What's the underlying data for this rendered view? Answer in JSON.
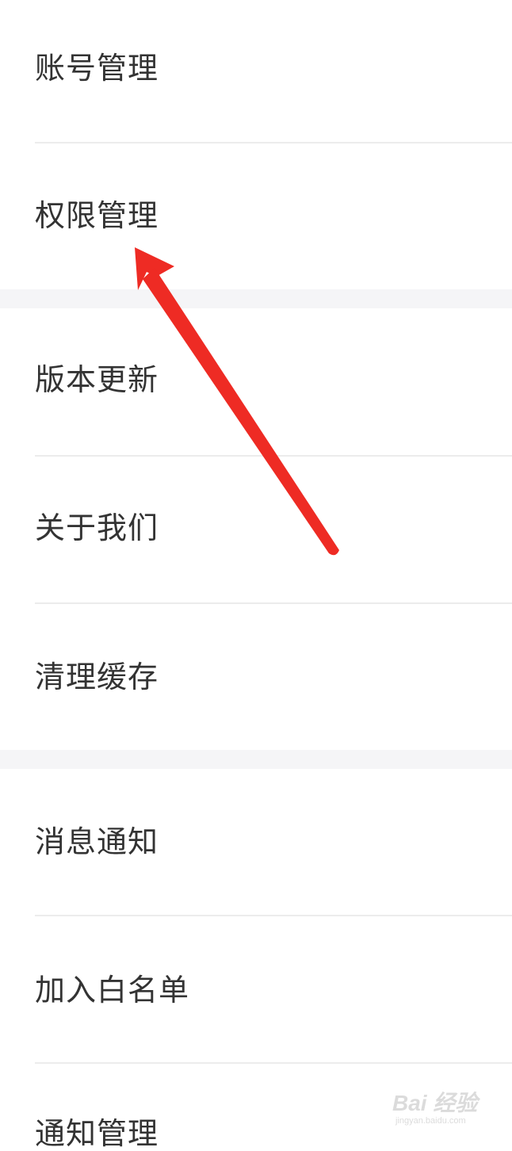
{
  "settings": {
    "items": [
      {
        "label": "账号管理"
      },
      {
        "label": "权限管理"
      },
      {
        "label": "版本更新"
      },
      {
        "label": "关于我们"
      },
      {
        "label": "清理缓存"
      },
      {
        "label": "消息通知"
      },
      {
        "label": "加入白名单"
      },
      {
        "label": "通知管理"
      }
    ]
  },
  "annotation": {
    "arrow_color": "#ee2b24",
    "arrow_icon": "red-arrow-pointing-to-permission-management"
  },
  "watermark": {
    "main": "Bai 经验",
    "sub": "jingyan.baidu.com"
  }
}
